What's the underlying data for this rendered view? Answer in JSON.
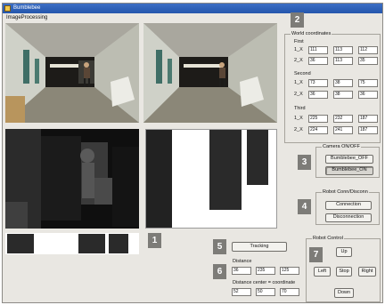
{
  "window": {
    "title": "Bumblebee",
    "menu": "ImageProcessing"
  },
  "badges": [
    "1",
    "2",
    "3",
    "4",
    "5",
    "6",
    "7"
  ],
  "world": {
    "group_label": "World coordinates",
    "first": {
      "label": "First",
      "row1_label": "1_X",
      "row1": [
        "111",
        "113",
        "112"
      ],
      "row2_label": "2_X",
      "row2": [
        "36",
        "113",
        "35"
      ]
    },
    "second": {
      "label": "Second",
      "row1_label": "1_X",
      "row1": [
        "73",
        "38",
        "75"
      ],
      "row2_label": "2_X",
      "row2": [
        "36",
        "38",
        "36"
      ]
    },
    "third": {
      "label": "Third",
      "row1_label": "1_X",
      "row1": [
        "225",
        "232",
        "187"
      ],
      "row2_label": "2_X",
      "row2": [
        "224",
        "241",
        "187"
      ]
    }
  },
  "camera": {
    "group_label": "Camera ON/OFF",
    "off_label": "Bumblebee_OFF",
    "on_label": "Bumblebee_ON"
  },
  "robot_conn": {
    "group_label": "Robot Conn/Disconn",
    "connect_label": "Connection",
    "disconnect_label": "Disconnection"
  },
  "tracking": {
    "label": "Tracking"
  },
  "distance": {
    "label": "Distance",
    "values": [
      "36",
      "235",
      "125"
    ]
  },
  "distance_center": {
    "label": "Distance center = coordinate",
    "values": [
      "52",
      "50",
      "70"
    ]
  },
  "robot_control": {
    "group_label": "Robot Control",
    "up": "Up",
    "left": "Left",
    "stop": "Stop",
    "right": "Right",
    "down": "Down"
  }
}
